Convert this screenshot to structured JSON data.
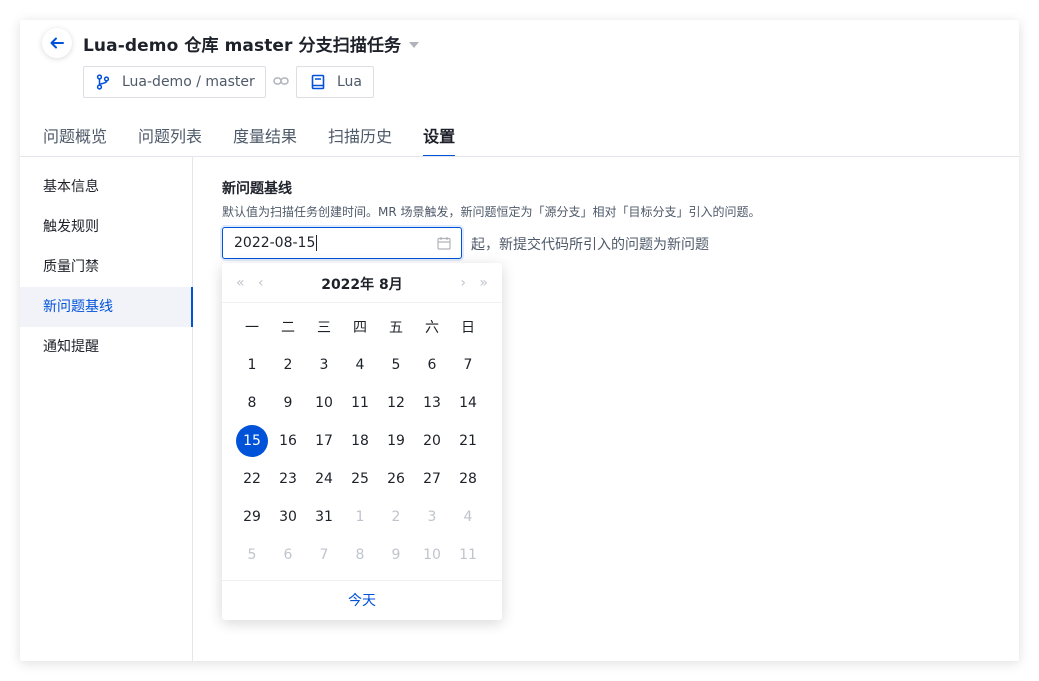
{
  "header": {
    "title": "Lua-demo 仓库 master 分支扫描任务",
    "branch_tag": "Lua-demo / master",
    "language_tag": "Lua"
  },
  "tabs": [
    {
      "label": "问题概览",
      "active": false
    },
    {
      "label": "问题列表",
      "active": false
    },
    {
      "label": "度量结果",
      "active": false
    },
    {
      "label": "扫描历史",
      "active": false
    },
    {
      "label": "设置",
      "active": true
    }
  ],
  "sidebar": {
    "items": [
      {
        "label": "基本信息",
        "active": false
      },
      {
        "label": "触发规则",
        "active": false
      },
      {
        "label": "质量门禁",
        "active": false
      },
      {
        "label": "新问题基线",
        "active": true
      },
      {
        "label": "通知提醒",
        "active": false
      }
    ]
  },
  "baseline": {
    "title": "新问题基线",
    "description": "默认值为扫描任务创建时间。MR 场景触发，新问题恒定为「源分支」相对「目标分支」引入的问题。",
    "date_value": "2022-08-15",
    "after_text": "起，新提交代码所引入的问题为新问题"
  },
  "datepicker": {
    "month_label": "2022年  8月",
    "weekdays": [
      "一",
      "二",
      "三",
      "四",
      "五",
      "六",
      "日"
    ],
    "weeks": [
      [
        "1",
        "2",
        "3",
        "4",
        "5",
        "6",
        "7"
      ],
      [
        "8",
        "9",
        "10",
        "11",
        "12",
        "13",
        "14"
      ],
      [
        "15",
        "16",
        "17",
        "18",
        "19",
        "20",
        "21"
      ],
      [
        "22",
        "23",
        "24",
        "25",
        "26",
        "27",
        "28"
      ],
      [
        "29",
        "30",
        "31",
        "1",
        "2",
        "3",
        "4"
      ],
      [
        "5",
        "6",
        "7",
        "8",
        "9",
        "10",
        "11"
      ]
    ],
    "muted_from_index": 31,
    "selected_day": "15",
    "today_label": "今天"
  },
  "colors": {
    "accent": "#0052d9",
    "text": "#1d2129",
    "muted": "#c0c4cc"
  }
}
